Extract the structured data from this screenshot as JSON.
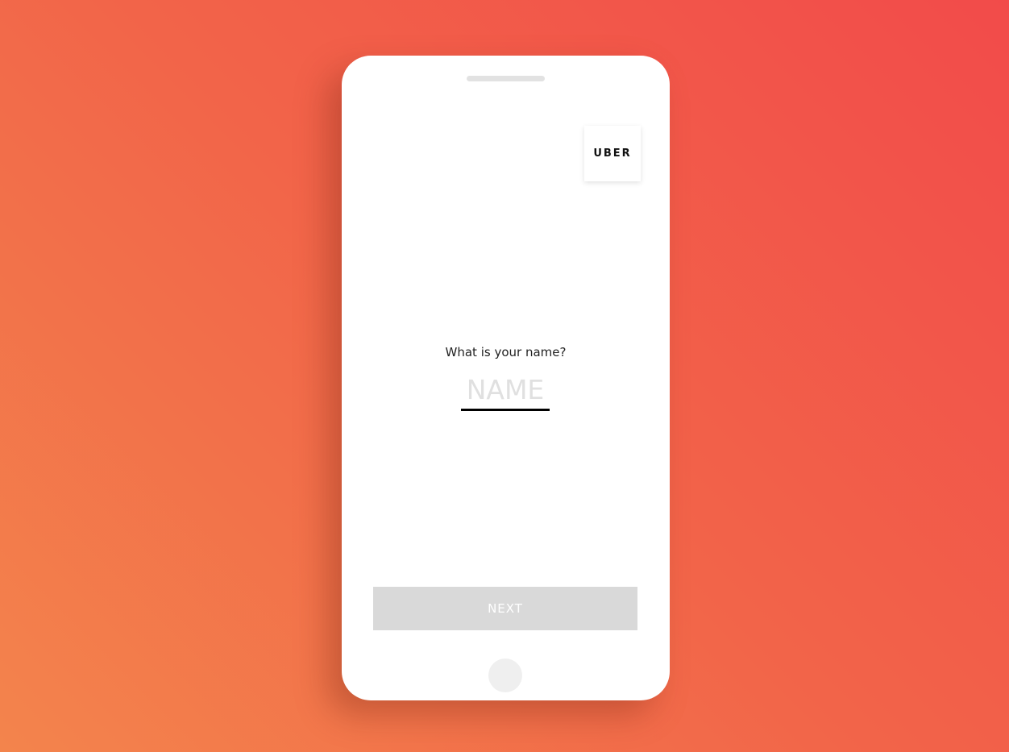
{
  "logo": {
    "text": "UBER",
    "icon": "uber-logo-icon"
  },
  "form": {
    "question": "What is your name?",
    "name_placeholder": "NAME",
    "name_value": ""
  },
  "actions": {
    "next_label": "NEXT"
  },
  "colors": {
    "background_start": "#f3844c",
    "background_end": "#f24b4a",
    "next_button": "#d9d9d9",
    "input_underline": "#000000"
  }
}
